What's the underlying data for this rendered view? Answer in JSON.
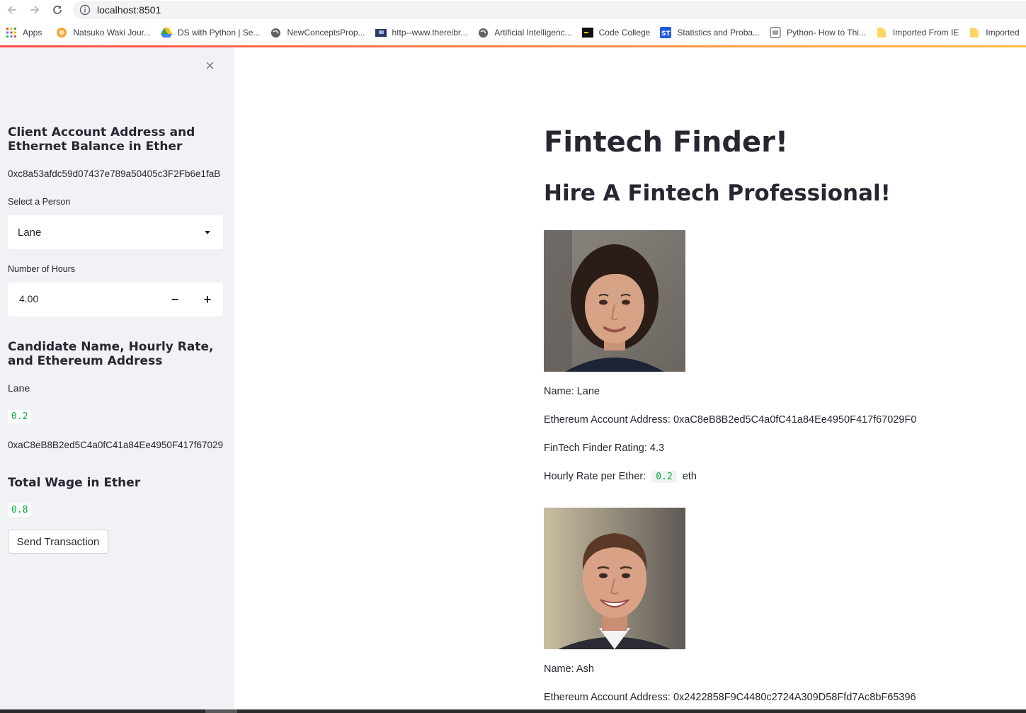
{
  "browser": {
    "url": "localhost:8501",
    "bookmarks": [
      {
        "label": "Apps",
        "icon": "apps-grid-icon"
      },
      {
        "label": "Natsuko Waki Jour...",
        "icon": "orange-circle-icon"
      },
      {
        "label": "DS with Python | Se...",
        "icon": "google-drive-icon"
      },
      {
        "label": "NewConceptsProp...",
        "icon": "globe-icon"
      },
      {
        "label": "http--www.thereibr...",
        "icon": "folder-page-icon"
      },
      {
        "label": "Artificial Intelligenc...",
        "icon": "globe-icon"
      },
      {
        "label": "Code College",
        "icon": "code-college-icon"
      },
      {
        "label": "Statistics and Proba...",
        "icon": "st-icon"
      },
      {
        "label": "Python- How to Thi...",
        "icon": "page-icon"
      },
      {
        "label": "Imported From IE",
        "icon": "folder-icon"
      },
      {
        "label": "Imported",
        "icon": "folder-icon"
      }
    ],
    "colors": {
      "accent_start": "#ff4b4b",
      "accent_end": "#ffbd45"
    }
  },
  "sidebar": {
    "close_symbol": "×",
    "client_heading": "Client Account Address and Ethernet Balance in Ether",
    "client_address": "0xc8a53afdc59d07437e789a50405c3F2Fb6e1faB",
    "select_label": "Select a Person",
    "select_value": "Lane",
    "hours_label": "Number of Hours",
    "hours_value": "4.00",
    "minus_symbol": "−",
    "plus_symbol": "+",
    "candidate_heading": "Candidate Name, Hourly Rate, and Ethereum Address",
    "candidate_name": "Lane",
    "candidate_rate": "0.2",
    "candidate_address": "0xaC8eB8B2ed5C4a0fC41a84Ee4950F417f67029",
    "wage_heading": "Total Wage in Ether",
    "wage_value": "0.8",
    "send_button": "Send Transaction"
  },
  "main": {
    "title": "Fintech Finder!",
    "subtitle": "Hire A Fintech Professional!",
    "candidates": [
      {
        "name_line": "Name: Lane",
        "address_line": "Ethereum Account Address: 0xaC8eB8B2ed5C4a0fC41a84Ee4950F417f67029F0",
        "rating_line": "FinTech Finder Rating: 4.3",
        "rate_prefix": "Hourly Rate per Ether:",
        "rate_value": "0.2",
        "rate_suffix": "eth"
      },
      {
        "name_line": "Name: Ash",
        "address_line": "Ethereum Account Address: 0x2422858F9C4480c2724A309D58Ffd7Ac8bF65396"
      }
    ]
  }
}
